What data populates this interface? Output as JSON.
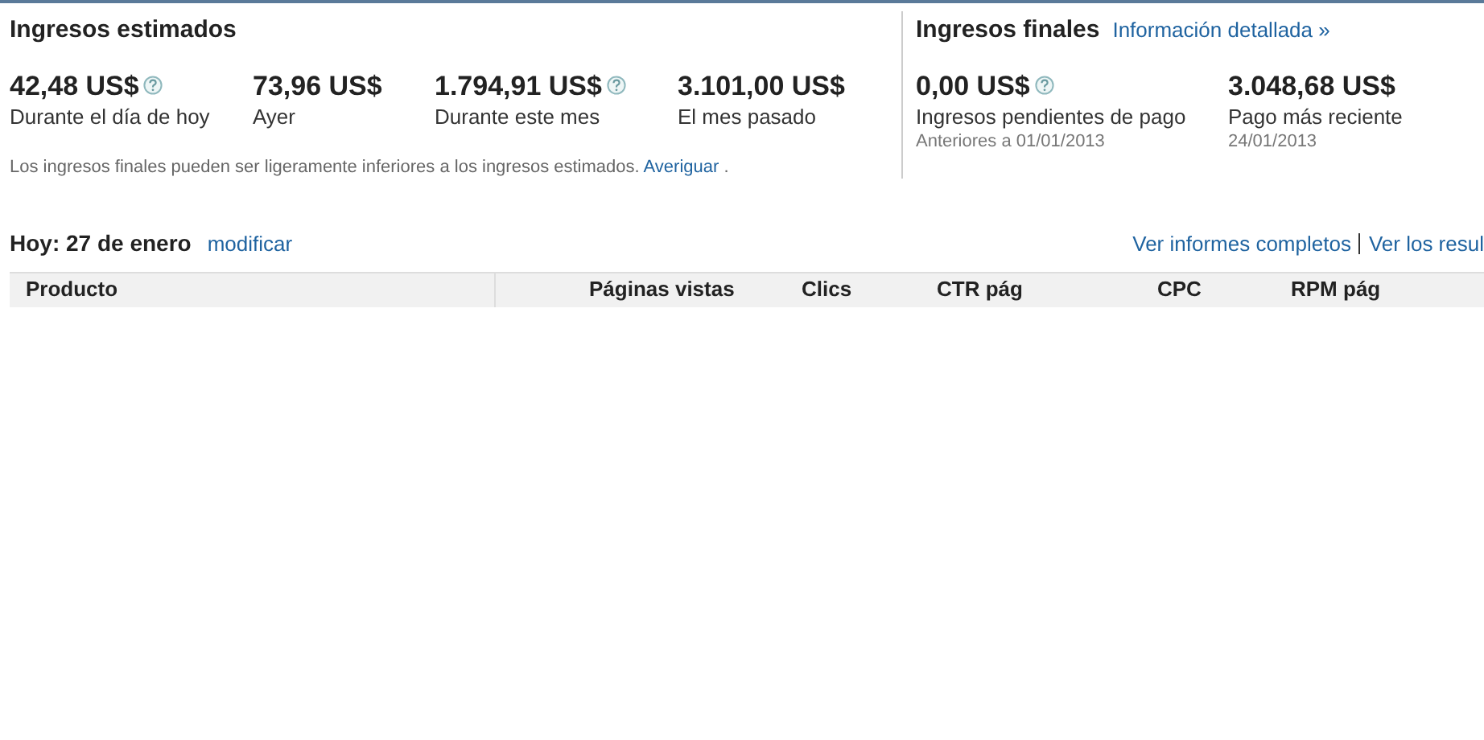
{
  "estimated": {
    "title": "Ingresos estimados",
    "metrics": [
      {
        "value": "42,48 US$",
        "label": "Durante el día de hoy",
        "help": true
      },
      {
        "value": "73,96 US$",
        "label": "Ayer",
        "help": false
      },
      {
        "value": "1.794,91 US$",
        "label": "Durante este mes",
        "help": true
      },
      {
        "value": "3.101,00 US$",
        "label": "El mes pasado",
        "help": false
      }
    ],
    "note": "Los ingresos finales pueden ser ligeramente inferiores a los ingresos estimados.",
    "note_link": "Averiguar",
    "note_end": "."
  },
  "final": {
    "title": "Ingresos finales",
    "link": "Información detallada »",
    "metrics": [
      {
        "value": "0,00 US$",
        "label": "Ingresos pendientes de pago",
        "sub": "Anteriores a 01/01/2013",
        "help": true
      },
      {
        "value": "3.048,68 US$",
        "label": "Pago más reciente",
        "sub": "24/01/2013",
        "help": false
      }
    ]
  },
  "today": {
    "title": "Hoy: 27 de enero",
    "edit_link": "modificar",
    "links": [
      "Ver informes completos",
      "Ver los resul"
    ]
  },
  "table": {
    "columns": [
      "Producto",
      "Páginas vistas",
      "Clics",
      "CTR pág",
      "CPC",
      "RPM pág"
    ]
  }
}
